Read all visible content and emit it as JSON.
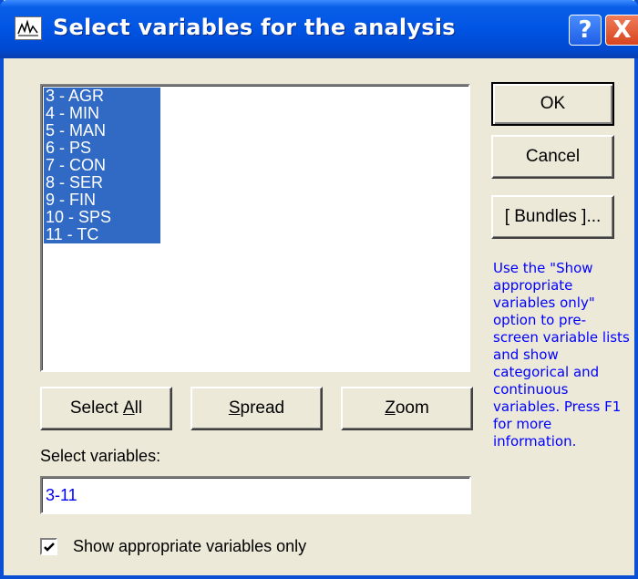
{
  "window": {
    "title": "Select variables for the analysis",
    "help_button": "?",
    "close_button": "X"
  },
  "variable_list": {
    "items": [
      "3 - AGR",
      "4 - MIN",
      "5 - MAN",
      "6 - PS",
      "7 - CON",
      "8 - SER",
      "9 - FIN",
      "10 - SPS",
      "11 - TC"
    ]
  },
  "buttons": {
    "ok": "OK",
    "cancel": "Cancel",
    "bundles": "[ Bundles ]...",
    "select_all_pre": "Select ",
    "select_all_key": "A",
    "select_all_post": "ll",
    "spread_key": "S",
    "spread_post": "pread",
    "zoom_key": "Z",
    "zoom_post": "oom"
  },
  "help_text": "Use the \"Show appropriate variables only\" option to pre-screen variable lists and show categorical and continuous variables. Press F1 for more information.",
  "select_variables": {
    "label": "Select variables:",
    "value": "3-11"
  },
  "show_appropriate": {
    "label": "Show appropriate variables only",
    "checked": true
  },
  "colors": {
    "title_bar": "#0054e3",
    "selection": "#316ac5",
    "help_text": "#0000ff",
    "dialog_bg": "#ece9d8"
  },
  "icons": {
    "app": "chart-app-icon",
    "help": "help-icon",
    "close": "close-icon",
    "check": "checkmark-icon"
  }
}
